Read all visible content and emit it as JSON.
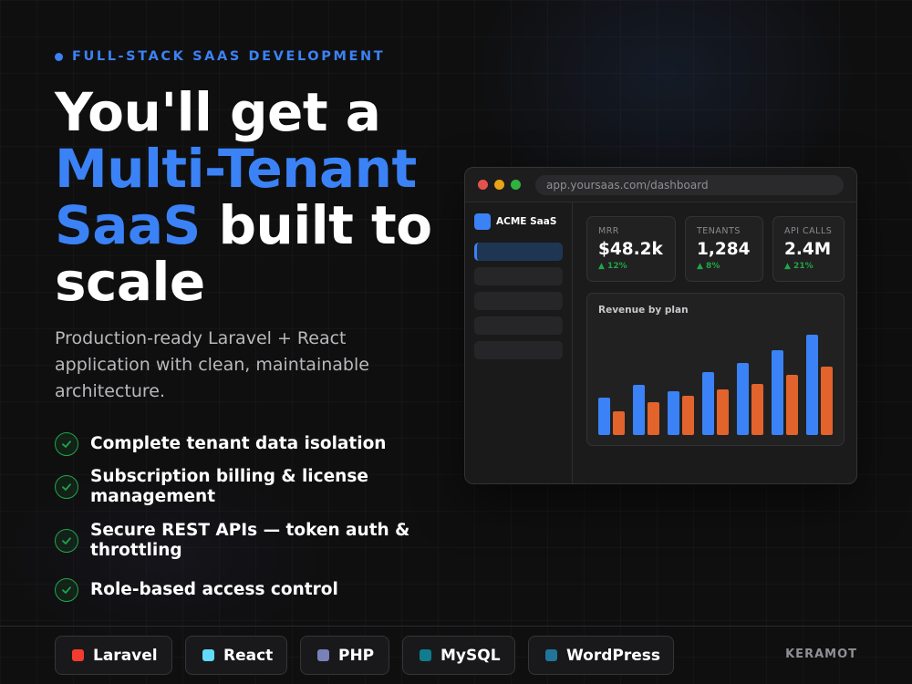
{
  "eyebrow": {
    "text": "FULL-STACK SAAS DEVELOPMENT"
  },
  "headline": {
    "line1": "You'll get a",
    "line2_accent": "Multi-Tenant",
    "line3_accent": "SaaS",
    "line3_rest": " built to",
    "line4": "scale"
  },
  "subtitle": "Production-ready Laravel + React application with clean, maintainable architecture.",
  "features": [
    "Complete tenant data isolation",
    "Subscription billing & license management",
    "Secure REST APIs — token auth & throttling",
    "Role-based access control"
  ],
  "browser": {
    "url": "app.yoursaas.com/dashboard",
    "brand": "ACME SaaS",
    "nav_items": 5,
    "stats": [
      {
        "label": "MRR",
        "value": "$48.2k",
        "delta": "▲ 12%"
      },
      {
        "label": "TENANTS",
        "value": "1,284",
        "delta": "▲ 8%"
      },
      {
        "label": "API CALLS",
        "value": "2.4M",
        "delta": "▲ 21%"
      }
    ]
  },
  "chart_data": {
    "type": "bar",
    "title": "Revenue by plan",
    "categories": [
      "",
      "",
      "",
      "",
      "",
      "",
      ""
    ],
    "series": [
      {
        "color": "#3b82f6",
        "values": [
          41,
          55,
          48,
          69,
          79,
          93,
          110
        ]
      },
      {
        "color": "#e2632c",
        "values": [
          26,
          36,
          43,
          50,
          56,
          66,
          75
        ]
      }
    ],
    "ylim": [
      0,
      115
    ],
    "grid": false,
    "legend": "none"
  },
  "tech_stack": [
    {
      "label": "Laravel",
      "color": "#f53b2f"
    },
    {
      "label": "React",
      "color": "#61dafb"
    },
    {
      "label": "PHP",
      "color": "#7a80b8"
    },
    {
      "label": "MySQL",
      "color": "#0f7d8e"
    },
    {
      "label": "WordPress",
      "color": "#21759b"
    }
  ],
  "credit": "KERAMOT",
  "colors": {
    "accent": "#3b82f6",
    "success": "#22a447",
    "background": "#0f0f10"
  }
}
